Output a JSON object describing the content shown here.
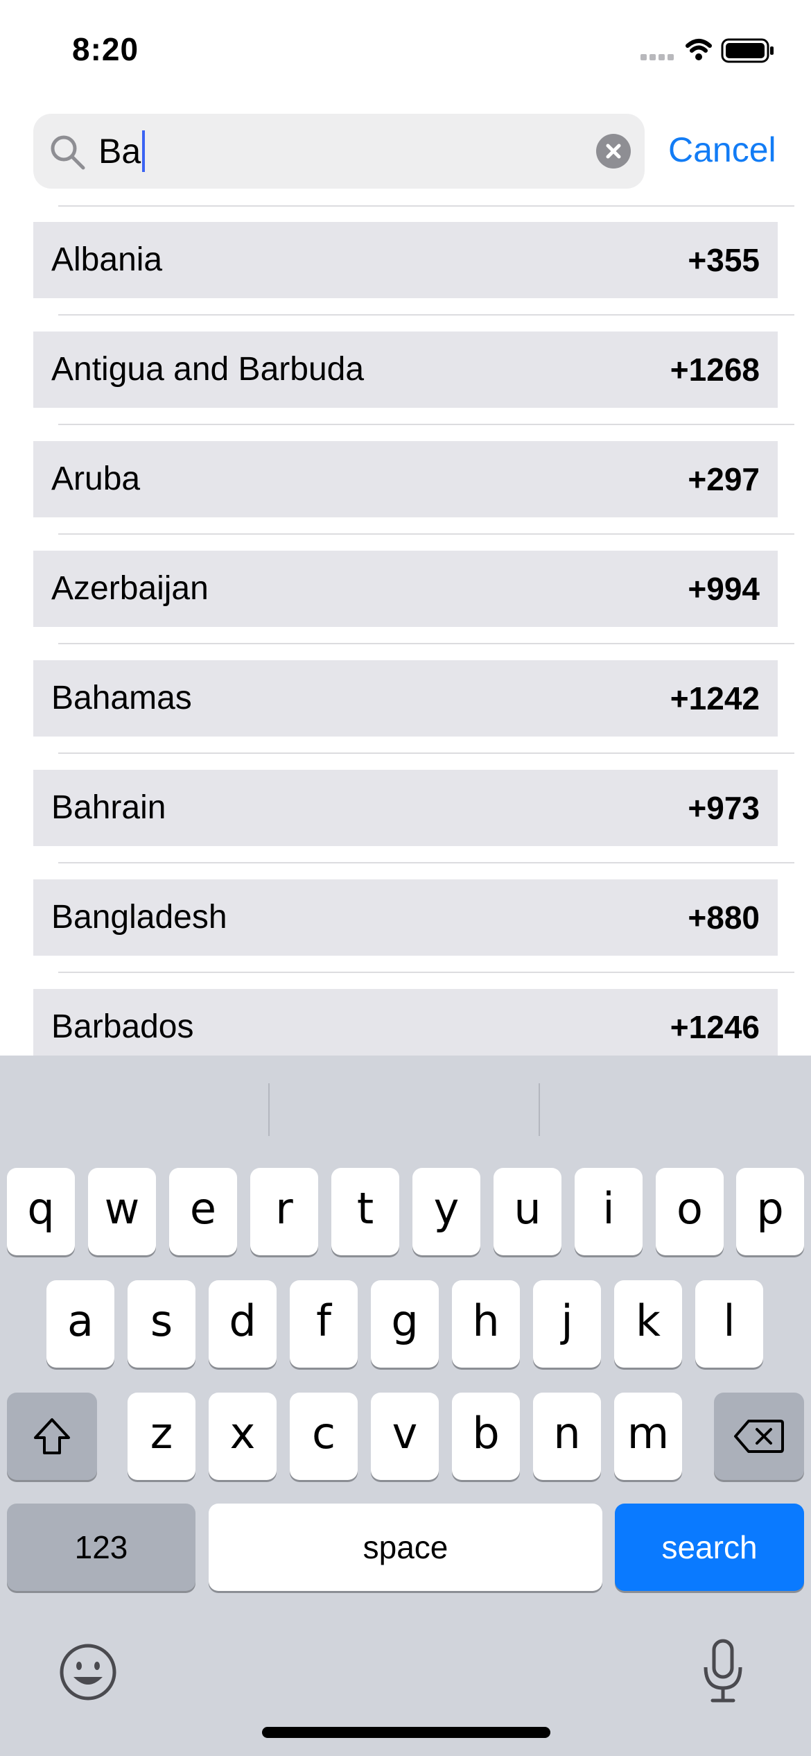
{
  "status_bar": {
    "time": "8:20"
  },
  "search": {
    "query": "Ba",
    "cancel_label": "Cancel"
  },
  "countries": [
    {
      "name": "Albania",
      "code": "+355"
    },
    {
      "name": "Antigua and Barbuda",
      "code": "+1268"
    },
    {
      "name": "Aruba",
      "code": "+297"
    },
    {
      "name": "Azerbaijan",
      "code": "+994"
    },
    {
      "name": "Bahamas",
      "code": "+1242"
    },
    {
      "name": "Bahrain",
      "code": "+973"
    },
    {
      "name": "Bangladesh",
      "code": "+880"
    },
    {
      "name": "Barbados",
      "code": "+1246"
    }
  ],
  "keyboard": {
    "row1": [
      "q",
      "w",
      "e",
      "r",
      "t",
      "y",
      "u",
      "i",
      "o",
      "p"
    ],
    "row2": [
      "a",
      "s",
      "d",
      "f",
      "g",
      "h",
      "j",
      "k",
      "l"
    ],
    "row3": [
      "z",
      "x",
      "c",
      "v",
      "b",
      "n",
      "m"
    ],
    "numbers_label": "123",
    "space_label": "space",
    "return_label": "search"
  },
  "colors": {
    "accent": "#127cf5",
    "row_background": "#e5e5ea",
    "keyboard_background": "#d1d4db",
    "return_key": "#0a7aff"
  }
}
